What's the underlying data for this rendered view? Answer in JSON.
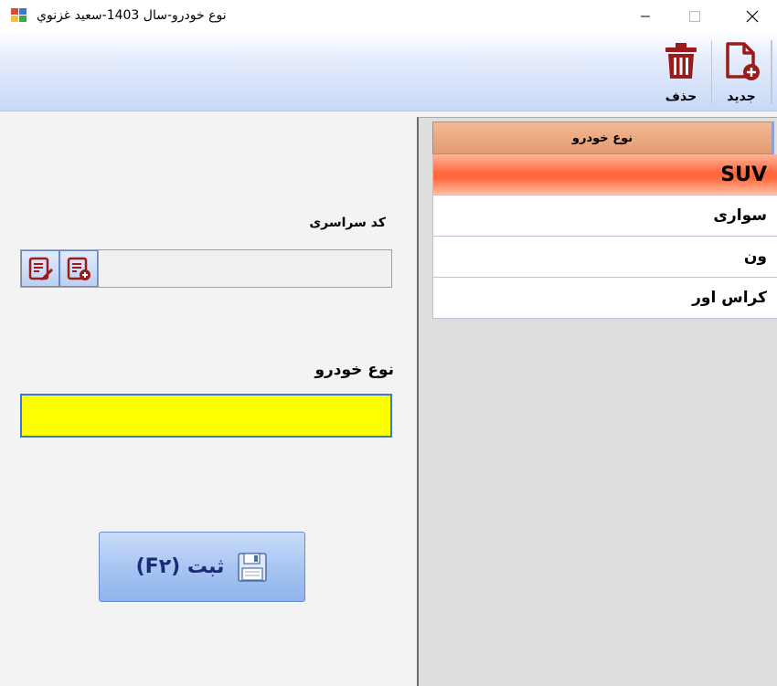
{
  "window": {
    "title": "نوع خودرو-سال 1403-سعيد غزنوي",
    "minimize_icon": "minimize-icon",
    "maximize_icon": "maximize-icon",
    "close_icon": "close-icon"
  },
  "toolbar": {
    "new_label": "جديد",
    "delete_label": "حذف",
    "new_icon": "new-file-icon",
    "delete_icon": "trash-icon",
    "accent_color": "#9b1b1b"
  },
  "form": {
    "code_label": "کد سراسری",
    "code_value": "",
    "type_label": "نوع خودرو",
    "type_value": "",
    "type_input_color": "#ffff00",
    "save_label": "ثبت (F۲)",
    "save_icon": "floppy-disk-icon"
  },
  "grid": {
    "header": "نوع خودرو",
    "rows": [
      "SUV",
      "سواری",
      "ون",
      "کراس اور"
    ],
    "selected_index": 0,
    "selected_color": "#ff6a3d"
  }
}
